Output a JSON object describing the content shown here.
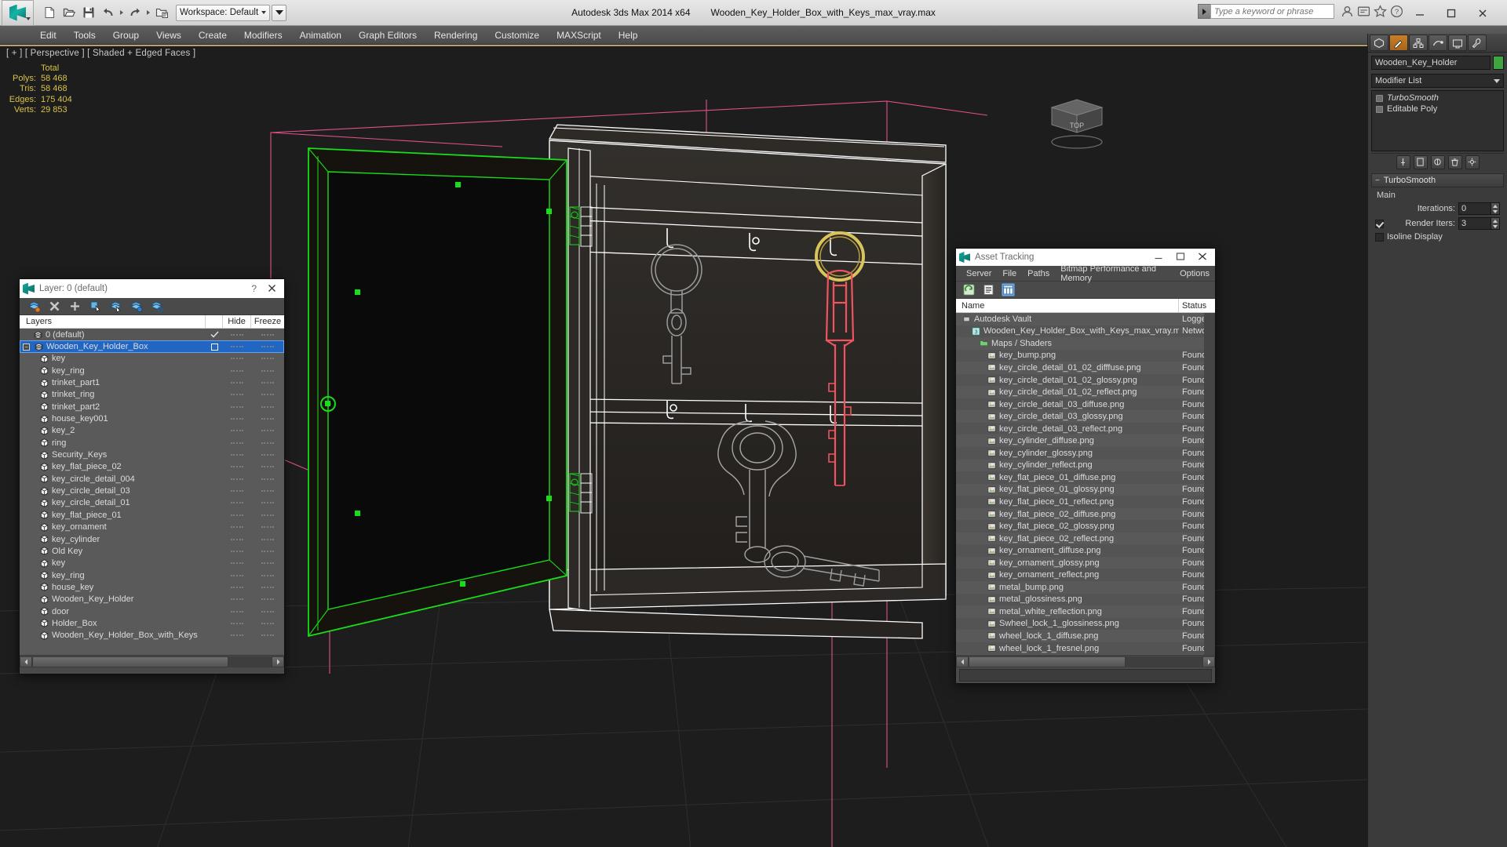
{
  "app": {
    "title": "Autodesk 3ds Max  2014 x64",
    "filename": "Wooden_Key_Holder_Box_with_Keys_max_vray.max",
    "workspace": "Workspace: Default",
    "search_placeholder": "Type a keyword or phrase"
  },
  "menubar": {
    "items": [
      "Edit",
      "Tools",
      "Group",
      "Views",
      "Create",
      "Modifiers",
      "Animation",
      "Graph Editors",
      "Rendering",
      "Customize",
      "MAXScript",
      "Help"
    ]
  },
  "viewport": {
    "label": "[ + ] [ Perspective ] [ Shaded + Edged Faces ]",
    "stats": {
      "header": "Total",
      "rows": [
        {
          "label": "Polys:",
          "value": "58 468"
        },
        {
          "label": "Tris:",
          "value": "58 468"
        },
        {
          "label": "Edges:",
          "value": "175 404"
        },
        {
          "label": "Verts:",
          "value": "29 853"
        }
      ]
    }
  },
  "command_panel": {
    "object_name": "Wooden_Key_Holder",
    "object_color": "#3fa63f",
    "modifier_list_label": "Modifier List",
    "stack": [
      {
        "label": "TurboSmooth",
        "italic": true
      },
      {
        "label": "Editable Poly",
        "italic": false
      }
    ],
    "rollouts": [
      {
        "title": "TurboSmooth",
        "group": "Main",
        "params": [
          {
            "label": "Iterations:",
            "value": "0"
          },
          {
            "label": "Render Iters:",
            "value": "3",
            "checkbox": true
          }
        ]
      },
      {
        "title": "Isoline Display"
      }
    ]
  },
  "layer_dialog": {
    "title": "Layer: 0 (default)",
    "columns": [
      "Layers",
      "Hide",
      "Freeze"
    ],
    "rows": [
      {
        "name": "0 (default)",
        "type": "layer",
        "indent": 0,
        "check": true,
        "selected": false,
        "expander": false
      },
      {
        "name": "Wooden_Key_Holder_Box",
        "type": "layer",
        "indent": 0,
        "check": false,
        "selected": true,
        "expander": true,
        "box": true
      },
      {
        "name": "key",
        "type": "object",
        "indent": 1
      },
      {
        "name": "key_ring",
        "type": "object",
        "indent": 1
      },
      {
        "name": "trinket_part1",
        "type": "object",
        "indent": 1
      },
      {
        "name": "trinket_ring",
        "type": "object",
        "indent": 1
      },
      {
        "name": "trinket_part2",
        "type": "object",
        "indent": 1
      },
      {
        "name": "house_key001",
        "type": "object",
        "indent": 1
      },
      {
        "name": "key_2",
        "type": "object",
        "indent": 1
      },
      {
        "name": "ring",
        "type": "object",
        "indent": 1
      },
      {
        "name": "Security_Keys",
        "type": "object",
        "indent": 1
      },
      {
        "name": "key_flat_piece_02",
        "type": "object",
        "indent": 1
      },
      {
        "name": "key_circle_detail_004",
        "type": "object",
        "indent": 1
      },
      {
        "name": "key_circle_detail_03",
        "type": "object",
        "indent": 1
      },
      {
        "name": "key_circle_detail_01",
        "type": "object",
        "indent": 1
      },
      {
        "name": "key_flat_piece_01",
        "type": "object",
        "indent": 1
      },
      {
        "name": "key_ornament",
        "type": "object",
        "indent": 1
      },
      {
        "name": "key_cylinder",
        "type": "object",
        "indent": 1
      },
      {
        "name": "Old Key",
        "type": "object",
        "indent": 1
      },
      {
        "name": "key",
        "type": "object",
        "indent": 1
      },
      {
        "name": "key_ring",
        "type": "object",
        "indent": 1
      },
      {
        "name": "house_key",
        "type": "object",
        "indent": 1
      },
      {
        "name": "Wooden_Key_Holder",
        "type": "object",
        "indent": 1
      },
      {
        "name": "door",
        "type": "object",
        "indent": 1
      },
      {
        "name": "Holder_Box",
        "type": "object",
        "indent": 1
      },
      {
        "name": "Wooden_Key_Holder_Box_with_Keys",
        "type": "object",
        "indent": 1
      }
    ]
  },
  "asset_tracking": {
    "title": "Asset Tracking",
    "menu": [
      "Server",
      "File",
      "Paths",
      "Bitmap Performance and Memory",
      "Options"
    ],
    "columns": [
      "Name",
      "Status"
    ],
    "rows": [
      {
        "name": "Autodesk Vault",
        "status": "Logged",
        "indent": 0,
        "icon": "vault"
      },
      {
        "name": "Wooden_Key_Holder_Box_with_Keys_max_vray.max",
        "status": "Networ",
        "indent": 1,
        "icon": "max"
      },
      {
        "name": "Maps / Shaders",
        "status": "",
        "indent": 2,
        "icon": "folder"
      },
      {
        "name": "key_bump.png",
        "status": "Found",
        "indent": 3,
        "icon": "bitmap"
      },
      {
        "name": "key_circle_detail_01_02_difffuse.png",
        "status": "Found",
        "indent": 3,
        "icon": "bitmap"
      },
      {
        "name": "key_circle_detail_01_02_glossy.png",
        "status": "Found",
        "indent": 3,
        "icon": "bitmap"
      },
      {
        "name": "key_circle_detail_01_02_reflect.png",
        "status": "Found",
        "indent": 3,
        "icon": "bitmap"
      },
      {
        "name": "key_circle_detail_03_diffuse.png",
        "status": "Found",
        "indent": 3,
        "icon": "bitmap"
      },
      {
        "name": "key_circle_detail_03_glossy.png",
        "status": "Found",
        "indent": 3,
        "icon": "bitmap"
      },
      {
        "name": "key_circle_detail_03_reflect.png",
        "status": "Found",
        "indent": 3,
        "icon": "bitmap"
      },
      {
        "name": "key_cylinder_diffuse.png",
        "status": "Found",
        "indent": 3,
        "icon": "bitmap"
      },
      {
        "name": "key_cylinder_glossy.png",
        "status": "Found",
        "indent": 3,
        "icon": "bitmap"
      },
      {
        "name": "key_cylinder_reflect.png",
        "status": "Found",
        "indent": 3,
        "icon": "bitmap"
      },
      {
        "name": "key_flat_piece_01_diffuse.png",
        "status": "Found",
        "indent": 3,
        "icon": "bitmap"
      },
      {
        "name": "key_flat_piece_01_glossy.png",
        "status": "Found",
        "indent": 3,
        "icon": "bitmap"
      },
      {
        "name": "key_flat_piece_01_reflect.png",
        "status": "Found",
        "indent": 3,
        "icon": "bitmap"
      },
      {
        "name": "key_flat_piece_02_diffuse.png",
        "status": "Found",
        "indent": 3,
        "icon": "bitmap"
      },
      {
        "name": "key_flat_piece_02_glossy.png",
        "status": "Found",
        "indent": 3,
        "icon": "bitmap"
      },
      {
        "name": "key_flat_piece_02_reflect.png",
        "status": "Found",
        "indent": 3,
        "icon": "bitmap"
      },
      {
        "name": "key_ornament_diffuse.png",
        "status": "Found",
        "indent": 3,
        "icon": "bitmap"
      },
      {
        "name": "key_ornament_glossy.png",
        "status": "Found",
        "indent": 3,
        "icon": "bitmap"
      },
      {
        "name": "key_ornament_reflect.png",
        "status": "Found",
        "indent": 3,
        "icon": "bitmap"
      },
      {
        "name": "metal_bump.png",
        "status": "Found",
        "indent": 3,
        "icon": "bitmap"
      },
      {
        "name": "metal_glossiness.png",
        "status": "Found",
        "indent": 3,
        "icon": "bitmap"
      },
      {
        "name": "metal_white_reflection.png",
        "status": "Found",
        "indent": 3,
        "icon": "bitmap"
      },
      {
        "name": "Swheel_lock_1_glossiness.png",
        "status": "Found",
        "indent": 3,
        "icon": "bitmap"
      },
      {
        "name": "wheel_lock_1_diffuse.png",
        "status": "Found",
        "indent": 3,
        "icon": "bitmap"
      },
      {
        "name": "wheel_lock_1_fresnel.png",
        "status": "Found",
        "indent": 3,
        "icon": "bitmap"
      }
    ]
  }
}
